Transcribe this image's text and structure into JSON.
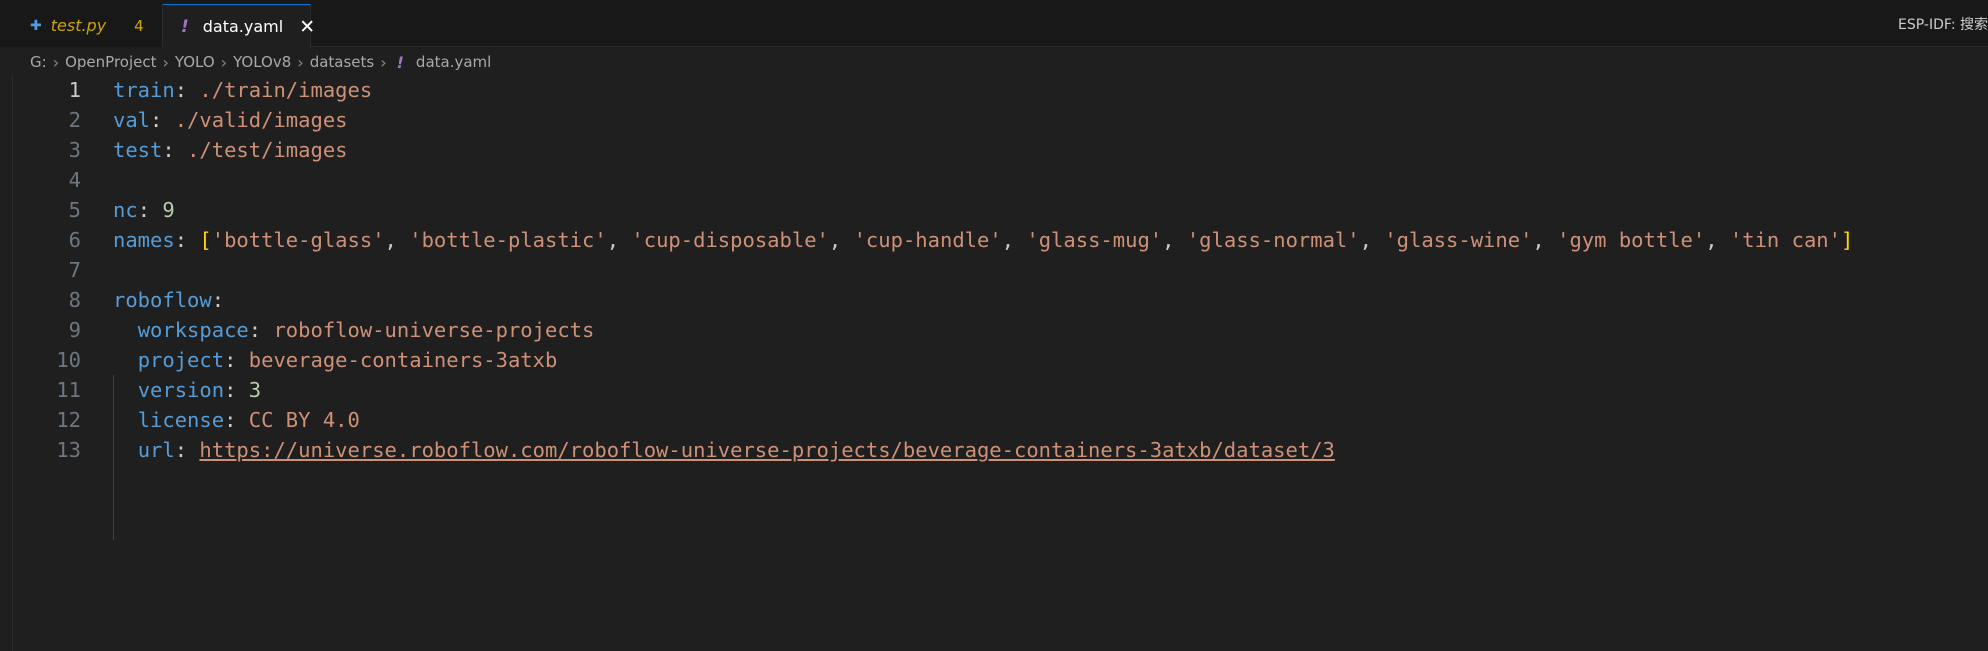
{
  "tabs": [
    {
      "icon": "python-icon",
      "name": "test.py",
      "badge": "4"
    },
    {
      "icon": "yaml-exclamation-icon",
      "name": "data.yaml",
      "close": "✕"
    }
  ],
  "status_right": "ESP-IDF: 搜索",
  "breadcrumb": {
    "items": [
      "G:",
      "OpenProject",
      "YOLO",
      "YOLOv8",
      "datasets"
    ],
    "file": "data.yaml",
    "separator": "›",
    "file_icon": "!"
  },
  "editor": {
    "lines": [
      {
        "num": "1",
        "tokens": [
          {
            "t": "k",
            "v": "train"
          },
          {
            "t": "p",
            "v": ": "
          },
          {
            "t": "s",
            "v": "./train/images"
          }
        ]
      },
      {
        "num": "2",
        "tokens": [
          {
            "t": "k",
            "v": "val"
          },
          {
            "t": "p",
            "v": ": "
          },
          {
            "t": "s",
            "v": "./valid/images"
          }
        ]
      },
      {
        "num": "3",
        "tokens": [
          {
            "t": "k",
            "v": "test"
          },
          {
            "t": "p",
            "v": ": "
          },
          {
            "t": "s",
            "v": "./test/images"
          }
        ]
      },
      {
        "num": "4",
        "tokens": []
      },
      {
        "num": "5",
        "tokens": [
          {
            "t": "k",
            "v": "nc"
          },
          {
            "t": "p",
            "v": ": "
          },
          {
            "t": "n",
            "v": "9"
          }
        ]
      },
      {
        "num": "6",
        "tokens": [
          {
            "t": "k",
            "v": "names"
          },
          {
            "t": "p",
            "v": ": "
          },
          {
            "t": "b",
            "v": "["
          },
          {
            "t": "s",
            "v": "'bottle-glass'"
          },
          {
            "t": "p",
            "v": ", "
          },
          {
            "t": "s",
            "v": "'bottle-plastic'"
          },
          {
            "t": "p",
            "v": ", "
          },
          {
            "t": "s",
            "v": "'cup-disposable'"
          },
          {
            "t": "p",
            "v": ", "
          },
          {
            "t": "s",
            "v": "'cup-handle'"
          },
          {
            "t": "p",
            "v": ", "
          },
          {
            "t": "s",
            "v": "'glass-mug'"
          },
          {
            "t": "p",
            "v": ", "
          },
          {
            "t": "s",
            "v": "'glass-normal'"
          },
          {
            "t": "p",
            "v": ", "
          },
          {
            "t": "s",
            "v": "'glass-wine'"
          },
          {
            "t": "p",
            "v": ", "
          },
          {
            "t": "s",
            "v": "'gym bottle'"
          },
          {
            "t": "p",
            "v": ", "
          },
          {
            "t": "s",
            "v": "'tin can'"
          },
          {
            "t": "b",
            "v": "]"
          }
        ]
      },
      {
        "num": "7",
        "tokens": []
      },
      {
        "num": "8",
        "tokens": [
          {
            "t": "k",
            "v": "roboflow"
          },
          {
            "t": "p",
            "v": ":"
          }
        ]
      },
      {
        "num": "9",
        "tokens": [
          {
            "t": "p",
            "v": "  "
          },
          {
            "t": "k",
            "v": "workspace"
          },
          {
            "t": "p",
            "v": ": "
          },
          {
            "t": "s",
            "v": "roboflow-universe-projects"
          }
        ]
      },
      {
        "num": "10",
        "tokens": [
          {
            "t": "p",
            "v": "  "
          },
          {
            "t": "k",
            "v": "project"
          },
          {
            "t": "p",
            "v": ": "
          },
          {
            "t": "s",
            "v": "beverage-containers-3atxb"
          }
        ]
      },
      {
        "num": "11",
        "tokens": [
          {
            "t": "p",
            "v": "  "
          },
          {
            "t": "k",
            "v": "version"
          },
          {
            "t": "p",
            "v": ": "
          },
          {
            "t": "n",
            "v": "3"
          }
        ]
      },
      {
        "num": "12",
        "tokens": [
          {
            "t": "p",
            "v": "  "
          },
          {
            "t": "k",
            "v": "license"
          },
          {
            "t": "p",
            "v": ": "
          },
          {
            "t": "s",
            "v": "CC BY 4.0"
          }
        ]
      },
      {
        "num": "13",
        "tokens": [
          {
            "t": "p",
            "v": "  "
          },
          {
            "t": "k",
            "v": "url"
          },
          {
            "t": "p",
            "v": ": "
          },
          {
            "t": "u",
            "v": "https://universe.roboflow.com/roboflow-universe-projects/beverage-containers-3atxb/dataset/3"
          }
        ]
      }
    ],
    "active_line": "1"
  }
}
